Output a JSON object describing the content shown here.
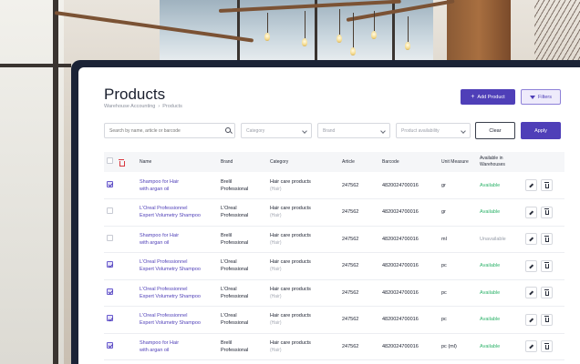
{
  "page": {
    "title": "Products",
    "breadcrumb": [
      "Warehouse Accounting",
      "Products"
    ],
    "add_button_label": "Add Product",
    "filters_button_label": "Filters"
  },
  "filters": {
    "search_placeholder": "Search by name, article or barcode",
    "category_placeholder": "Category",
    "brand_placeholder": "Brand",
    "availability_placeholder": "Product availability",
    "clear_label": "Clear",
    "apply_label": "Apply"
  },
  "table": {
    "columns": [
      "Name",
      "Brand",
      "Category",
      "Article",
      "Barcode",
      "Unit Measure",
      "Available in Warehouses"
    ],
    "rows": [
      {
        "checked": true,
        "name": [
          "Shampoo for Hair",
          "with argan oil"
        ],
        "brand": [
          "Brelil",
          "Professional"
        ],
        "category": "Hair care products",
        "category_sub": "(Hair)",
        "article": "247562",
        "barcode": "4820024700016",
        "unit": "gr",
        "availability": "Available",
        "available": true
      },
      {
        "checked": false,
        "name": [
          "L'Oreal Professionnel",
          "Expert Volumetry Shampoo"
        ],
        "brand": [
          "L'Oreal",
          "Professional"
        ],
        "category": "Hair care products",
        "category_sub": "(Hair)",
        "article": "247562",
        "barcode": "4820024700016",
        "unit": "gr",
        "availability": "Available",
        "available": true
      },
      {
        "checked": false,
        "name": [
          "Shampoo for Hair",
          "with argan oil"
        ],
        "brand": [
          "Brelil",
          "Professional"
        ],
        "category": "Hair care products",
        "category_sub": "(Hair)",
        "article": "247562",
        "barcode": "4820024700016",
        "unit": "ml",
        "availability": "Unavailable",
        "available": false
      },
      {
        "checked": true,
        "name": [
          "L'Oreal Professionnel",
          "Expert Volumetry Shampoo"
        ],
        "brand": [
          "L'Oreal",
          "Professional"
        ],
        "category": "Hair care products",
        "category_sub": "(Hair)",
        "article": "247562",
        "barcode": "4820024700016",
        "unit": "pc",
        "availability": "Available",
        "available": true
      },
      {
        "checked": true,
        "name": [
          "L'Oreal Professionnel",
          "Expert Volumetry Shampoo"
        ],
        "brand": [
          "L'Oreal",
          "Professional"
        ],
        "category": "Hair care products",
        "category_sub": "(Hair)",
        "article": "247562",
        "barcode": "4820024700016",
        "unit": "pc",
        "availability": "Available",
        "available": true
      },
      {
        "checked": true,
        "name": [
          "L'Oreal Professionnel",
          "Expert Volumetry Shampoo"
        ],
        "brand": [
          "L'Oreal",
          "Professional"
        ],
        "category": "Hair care products",
        "category_sub": "(Hair)",
        "article": "247562",
        "barcode": "4820024700016",
        "unit": "pc",
        "availability": "Available",
        "available": true
      },
      {
        "checked": true,
        "name": [
          "Shampoo for Hair",
          "with argan oil"
        ],
        "brand": [
          "Brelil",
          "Professional"
        ],
        "category": "Hair care products",
        "category_sub": "(Hair)",
        "article": "247562",
        "barcode": "4820024700016",
        "unit": "pc (ml)",
        "availability": "Available",
        "available": true
      }
    ]
  },
  "colors": {
    "accent": "#4f3fb8",
    "available": "#2fb36b",
    "unavailable": "#9aa0ab",
    "danger": "#d9363e",
    "panel": "#1b2336"
  },
  "icons": {
    "add": "plus-icon",
    "filters": "filter-icon",
    "search": "search-icon",
    "dropdown": "chevron-down-icon",
    "edit": "pencil-icon",
    "delete": "trash-icon"
  }
}
